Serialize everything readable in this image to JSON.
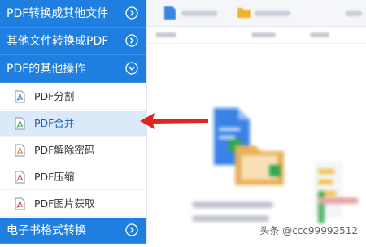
{
  "sidebar": {
    "categories": [
      {
        "label": "PDF转换成其他文件"
      },
      {
        "label": "其他文件转换成PDF"
      },
      {
        "label": "PDF的其他操作"
      },
      {
        "label": "电子书格式转换"
      }
    ],
    "items": [
      {
        "label": "PDF分割"
      },
      {
        "label": "PDF合并"
      },
      {
        "label": "PDF解除密码"
      },
      {
        "label": "PDF压缩"
      },
      {
        "label": "PDF图片获取"
      }
    ]
  },
  "watermark": {
    "text": "头条 @ccc99992512"
  },
  "colors": {
    "accent": "#1f7fe0",
    "active_row": "#dce9f8",
    "arrow": "#e0261f"
  },
  "icons": [
    "chevron-right-icon",
    "chevron-down-icon",
    "pdf-file-icon",
    "folder-icon",
    "add-file-icon"
  ]
}
